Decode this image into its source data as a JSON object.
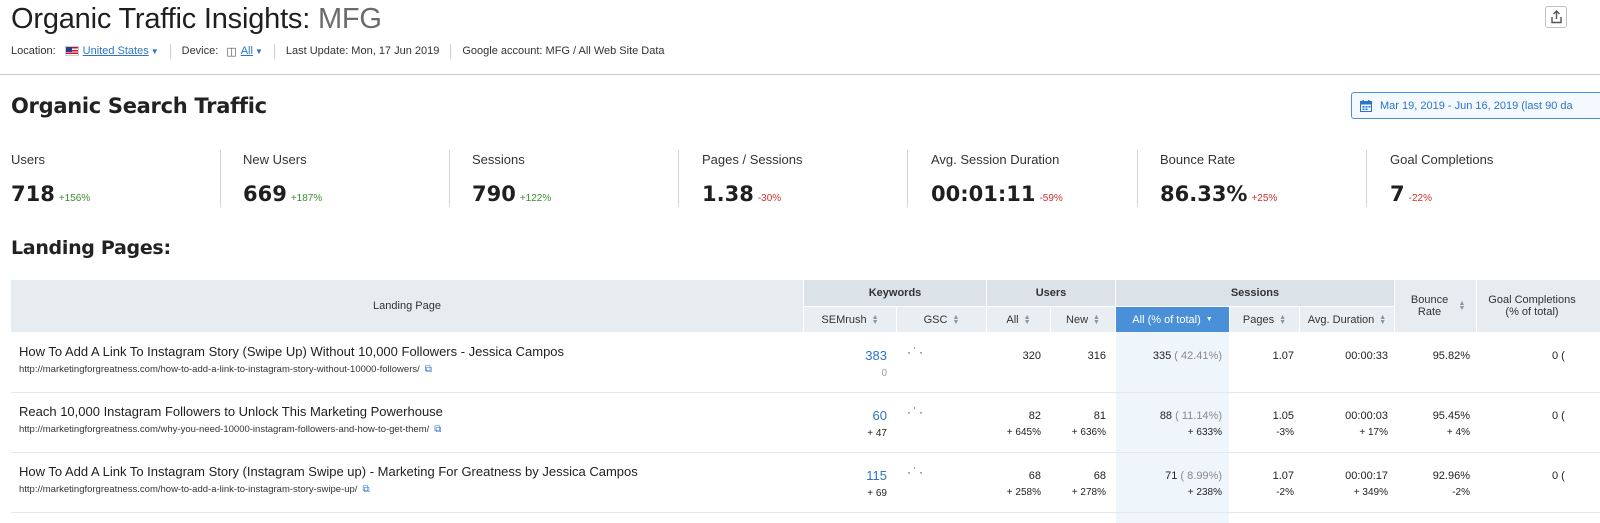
{
  "header": {
    "title": "Organic Traffic Insights:",
    "project": "MFG",
    "location_label": "Location:",
    "location_value": "United States",
    "device_label": "Device:",
    "device_value": "All",
    "last_update": "Last Update: Mon, 17 Jun 2019",
    "google_account": "Google account: MFG / All Web Site Data"
  },
  "section": {
    "title": "Organic Search Traffic",
    "date_range": "Mar 19, 2019 - Jun 16, 2019 (last 90 da"
  },
  "metrics": [
    {
      "label": "Users",
      "value": "718",
      "delta": "+156%",
      "trend": "pos"
    },
    {
      "label": "New Users",
      "value": "669",
      "delta": "+187%",
      "trend": "pos"
    },
    {
      "label": "Sessions",
      "value": "790",
      "delta": "+122%",
      "trend": "pos"
    },
    {
      "label": "Pages / Sessions",
      "value": "1.38",
      "delta": "-30%",
      "trend": "neg"
    },
    {
      "label": "Avg. Session Duration",
      "value": "00:01:11",
      "delta": "-59%",
      "trend": "neg"
    },
    {
      "label": "Bounce Rate",
      "value": "86.33%",
      "delta": "+25%",
      "trend": "neg"
    },
    {
      "label": "Goal Completions",
      "value": "7",
      "delta": "-22%",
      "trend": "neg"
    }
  ],
  "landing": {
    "title": "Landing Pages:",
    "headers": {
      "landing_page": "Landing Page",
      "keywords": "Keywords",
      "users": "Users",
      "sessions": "Sessions",
      "semrush": "SEMrush",
      "gsc": "GSC",
      "all": "All",
      "new": "New",
      "all_pct": "All (% of total)",
      "pages": "Pages",
      "avg_duration": "Avg. Duration",
      "bounce_rate": "Bounce Rate",
      "goal_completions": "Goal Completions (% of total)"
    },
    "rows": [
      {
        "title": "How To Add A Link To Instagram Story (Swipe Up) Without 10,000 Followers - Jessica Campos",
        "url": "http://marketingforgreatness.com/how-to-add-a-link-to-instagram-story-without-10000-followers/",
        "semrush": "383",
        "semrush_delta": "0",
        "users_all": "320",
        "users_all_delta": "",
        "users_new": "316",
        "users_new_delta": "",
        "sessions": "335",
        "sessions_pct": "( 42.41%)",
        "sessions_delta": "",
        "pages": "1.07",
        "pages_delta": "",
        "avg_duration": "00:00:33",
        "avg_duration_delta": "",
        "bounce": "95.82%",
        "bounce_delta": "",
        "goals": "0 ("
      },
      {
        "title": "Reach 10,000 Instagram Followers to Unlock This Marketing Powerhouse",
        "url": "http://marketingforgreatness.com/why-you-need-10000-instagram-followers-and-how-to-get-them/",
        "semrush": "60",
        "semrush_delta": "+ 47",
        "users_all": "82",
        "users_all_delta": "+ 645%",
        "users_new": "81",
        "users_new_delta": "+ 636%",
        "sessions": "88",
        "sessions_pct": "( 11.14%)",
        "sessions_delta": "+ 633%",
        "pages": "1.05",
        "pages_delta": "-3%",
        "avg_duration": "00:00:03",
        "avg_duration_delta": "+ 17%",
        "bounce": "95.45%",
        "bounce_delta": "+ 4%",
        "goals": "0 ("
      },
      {
        "title": "How To Add A Link To Instagram Story (Instagram Swipe up) - Marketing For Greatness by Jessica Campos",
        "url": "http://marketingforgreatness.com/how-to-add-a-link-to-instagram-story-swipe-up/",
        "semrush": "115",
        "semrush_delta": "+ 69",
        "users_all": "68",
        "users_all_delta": "+ 258%",
        "users_new": "68",
        "users_new_delta": "+ 278%",
        "sessions": "71",
        "sessions_pct": "( 8.99%)",
        "sessions_delta": "+ 238%",
        "pages": "1.07",
        "pages_delta": "-2%",
        "avg_duration": "00:00:17",
        "avg_duration_delta": "+ 349%",
        "bounce": "92.96%",
        "bounce_delta": "-2%",
        "goals": "0 ("
      }
    ]
  }
}
